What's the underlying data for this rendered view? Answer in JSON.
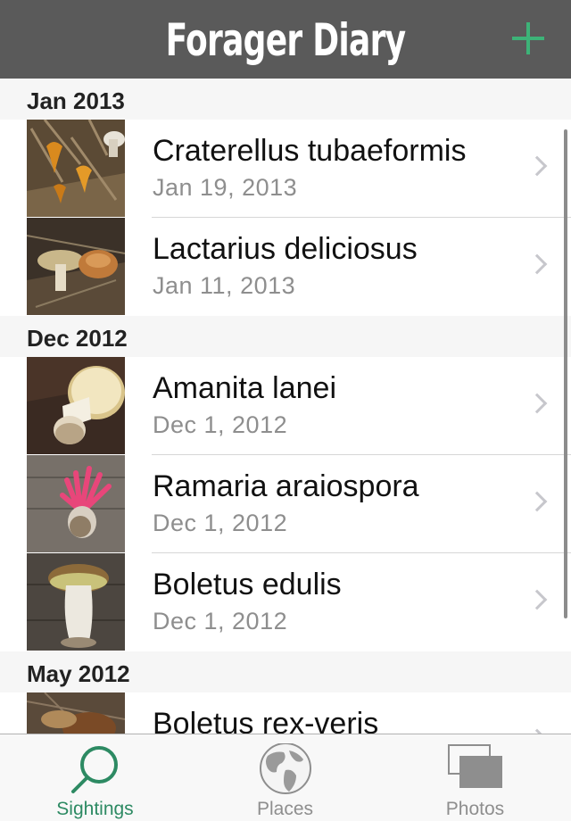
{
  "nav": {
    "title": "Forager Diary",
    "add_icon": "plus-icon",
    "accent_color": "#3db378"
  },
  "sections": [
    {
      "header": "Jan 2013",
      "rows": [
        {
          "species": "Craterellus tubaeformis",
          "date": "Jan 19, 2013",
          "thumb": "craterellus-photo"
        },
        {
          "species": "Lactarius deliciosus",
          "date": "Jan 11, 2013",
          "thumb": "lactarius-photo"
        }
      ]
    },
    {
      "header": "Dec 2012",
      "rows": [
        {
          "species": "Amanita lanei",
          "date": "Dec 1, 2012",
          "thumb": "amanita-photo"
        },
        {
          "species": "Ramaria araiospora",
          "date": "Dec 1, 2012",
          "thumb": "ramaria-photo"
        },
        {
          "species": "Boletus edulis",
          "date": "Dec 1, 2012",
          "thumb": "boletus-edulis-photo"
        }
      ]
    },
    {
      "header": "May 2012",
      "rows": [
        {
          "species": "Boletus rex-veris",
          "date": "",
          "thumb": "boletus-rex-veris-photo"
        }
      ]
    }
  ],
  "tabs": [
    {
      "label": "Sightings",
      "icon": "magnifier-icon",
      "active": true
    },
    {
      "label": "Places",
      "icon": "globe-icon",
      "active": false
    },
    {
      "label": "Photos",
      "icon": "photos-icon",
      "active": false
    }
  ],
  "colors": {
    "navbar": "#5a5a5a",
    "tab_active": "#2d8a63",
    "tab_inactive": "#8e8e8e"
  }
}
